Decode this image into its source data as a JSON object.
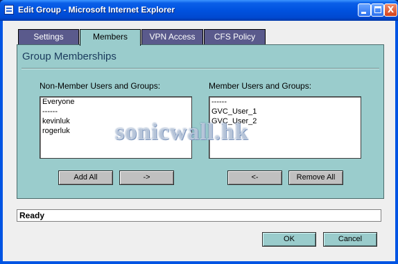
{
  "window": {
    "title": "Edit Group - Microsoft Internet Explorer",
    "controls": {
      "minimize": "minimize",
      "maximize": "maximize",
      "close": "X"
    }
  },
  "tabs": [
    {
      "label": "Settings",
      "active": false
    },
    {
      "label": "Members",
      "active": true
    },
    {
      "label": "VPN Access",
      "active": false
    },
    {
      "label": "CFS Policy",
      "active": false
    }
  ],
  "panel": {
    "heading": "Group Memberships",
    "non_member": {
      "label": "Non-Member Users and Groups:",
      "items": [
        "Everyone",
        "------",
        "kevinluk",
        "rogerluk"
      ]
    },
    "member": {
      "label": "Member Users and Groups:",
      "items": [
        "------",
        "GVC_User_1",
        "GVC_User_2"
      ]
    },
    "buttons": {
      "add_all": "Add All",
      "add": "->",
      "remove": "<-",
      "remove_all": "Remove All"
    }
  },
  "watermark": "sonicwall.hk",
  "status": "Ready",
  "dialog_buttons": {
    "ok": "OK",
    "cancel": "Cancel"
  },
  "colors": {
    "title_bar": "#0054e3",
    "panel": "#9acccc",
    "tab_inactive": "#5a5a8c",
    "heading": "#1a3a5c"
  }
}
